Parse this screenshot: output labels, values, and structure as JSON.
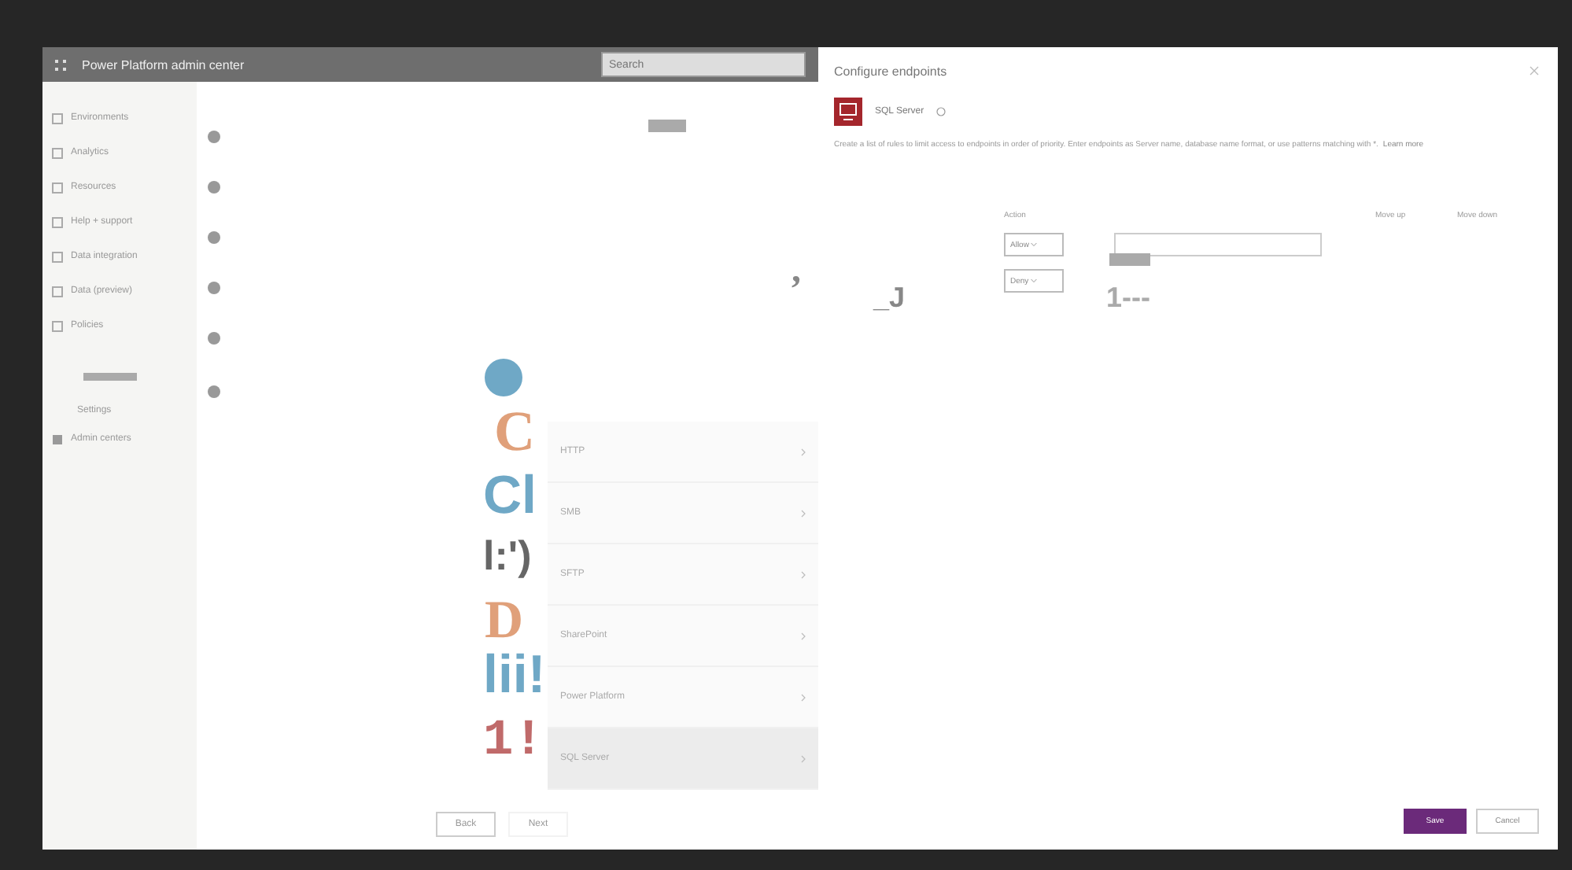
{
  "app": {
    "title": "Power Platform admin center",
    "search": {
      "placeholder": "Search"
    }
  },
  "sidebar": {
    "items": [
      {
        "label": "Environments"
      },
      {
        "label": "Analytics"
      },
      {
        "label": "Resources"
      },
      {
        "label": "Help + support"
      },
      {
        "label": "Data integration"
      },
      {
        "label": "Data (preview)"
      },
      {
        "label": "Policies"
      }
    ],
    "section": "Settings",
    "footer_item": "Admin centers"
  },
  "connectors": {
    "items": [
      {
        "label": "HTTP",
        "selected": false
      },
      {
        "label": "SMB",
        "selected": false
      },
      {
        "label": "SFTP",
        "selected": false
      },
      {
        "label": "SharePoint",
        "selected": false
      },
      {
        "label": "Power Platform",
        "selected": false
      },
      {
        "label": "SQL Server",
        "selected": true
      }
    ]
  },
  "wizard_buttons": [
    "Back",
    "Next"
  ],
  "panel": {
    "title": "Configure endpoints",
    "connector": "SQL Server",
    "description": "Create a list of rules to limit access to endpoints in order of priority. Enter endpoints as Server name, database name format, or use patterns matching with *.",
    "link": "Learn more",
    "columns": [
      "Action",
      "Move up",
      "Move down"
    ],
    "rules": [
      {
        "action": "Allow"
      },
      {
        "action": "Deny"
      }
    ],
    "buttons": [
      {
        "label": "Save",
        "kind": "primary"
      },
      {
        "label": "Cancel",
        "kind": "secondary"
      }
    ]
  },
  "overlay_marks": [
    {
      "text": "C",
      "color": "#e0a07a",
      "kind": "serif"
    },
    {
      "text": "Cl",
      "color": "#6fa8c6",
      "kind": "sans"
    },
    {
      "text": "l:')",
      "color": "#666666",
      "kind": "sans"
    },
    {
      "text": "D",
      "color": "#e0a07a",
      "kind": "serif"
    },
    {
      "text": "lii!",
      "color": "#6fa8c6",
      "kind": "sans"
    },
    {
      "text": "1!",
      "color": "#c06a6a",
      "kind": "mono"
    },
    {
      "text": ",",
      "color": "#888888",
      "kind": "serif"
    },
    {
      "text": "_J",
      "color": "#888888",
      "kind": "sans"
    },
    {
      "text": "1---",
      "color": "#aaaaaa",
      "kind": "sans"
    }
  ]
}
